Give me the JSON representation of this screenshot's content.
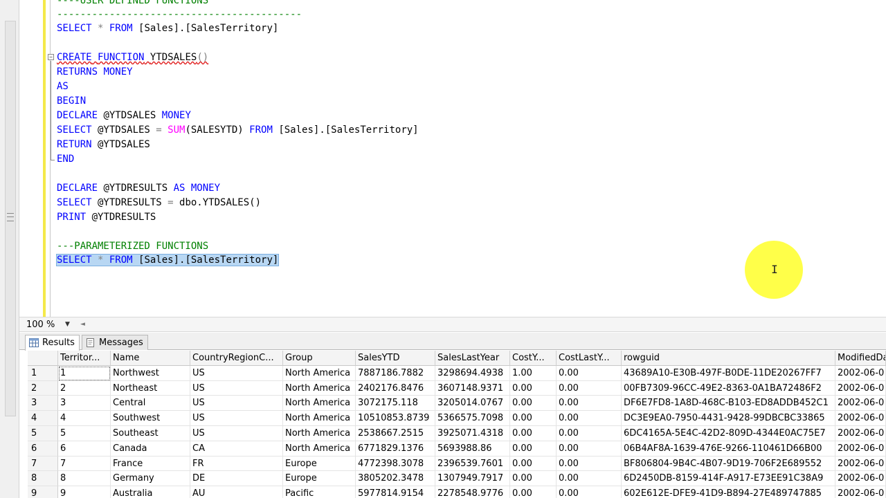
{
  "editor": {
    "lines": {
      "l0": "----USER DEFINED FUNCTIONS",
      "l1": "------------------------------------------",
      "l2_kw1": "SELECT",
      "l2_op": " * ",
      "l2_kw2": "FROM",
      "l2_rest": " [Sales].[SalesTerritory]",
      "l4_kw1": "CREATE",
      "l4_kw2": "FUNCTION",
      "l4_name": "YTDSALES",
      "l4_paren": "()",
      "l5_kw1": "RETURNS",
      "l5_kw2": "MONEY",
      "l6_kw": "AS",
      "l7_kw": "BEGIN",
      "l8_kw1": "DECLARE",
      "l8_var": " @YTDSALES ",
      "l8_kw2": "MONEY",
      "l9_kw1": "SELECT",
      "l9_var": " @YTDSALES ",
      "l9_eq": "=",
      "l9_fn": " SUM",
      "l9_arg": "(SALESYTD) ",
      "l9_kw2": "FROM",
      "l9_rest": " [Sales].[SalesTerritory]",
      "l10_kw": "RETURN",
      "l10_var": " @YTDSALES",
      "l11_kw": "END",
      "l13_kw1": "DECLARE",
      "l13_var": " @YTDRESULTS ",
      "l13_kw2": "AS",
      "l13_kw3": " MONEY",
      "l14_kw1": "SELECT",
      "l14_var": " @YTDRESULTS ",
      "l14_eq": "=",
      "l14_rest": " dbo.YTDSALES()",
      "l15_kw": "PRINT",
      "l15_var": " @YTDRESULTS",
      "l17": "---PARAMETERIZED FUNCTIONS",
      "l18_kw1": "SELECT",
      "l18_op": " * ",
      "l18_kw2": "FROM",
      "l18_rest": " [Sales].[SalesTerritory]"
    },
    "fold_symbol": "−",
    "ibeam": "I"
  },
  "zoom": {
    "value": "100 %",
    "arrow": "▼",
    "scroll_left": "◄"
  },
  "tabs": [
    {
      "label": "Results"
    },
    {
      "label": "Messages"
    }
  ],
  "grid": {
    "columns": [
      "Territor...",
      "Name",
      "CountryRegionC...",
      "Group",
      "SalesYTD",
      "SalesLastYear",
      "CostY...",
      "CostLastY...",
      "rowguid",
      "ModifiedDa"
    ],
    "rows": [
      {
        "n": "1",
        "cells": [
          "1",
          "Northwest",
          "US",
          "North America",
          "7887186.7882",
          "3298694.4938",
          "1.00",
          "0.00",
          "43689A10-E30B-497F-B0DE-11DE20267FF7",
          "2002-06-0"
        ]
      },
      {
        "n": "2",
        "cells": [
          "2",
          "Northeast",
          "US",
          "North America",
          "2402176.8476",
          "3607148.9371",
          "0.00",
          "0.00",
          "00FB7309-96CC-49E2-8363-0A1BA72486F2",
          "2002-06-0"
        ]
      },
      {
        "n": "3",
        "cells": [
          "3",
          "Central",
          "US",
          "North America",
          "3072175.118",
          "3205014.0767",
          "0.00",
          "0.00",
          "DF6E7FD8-1A8D-468C-B103-ED8ADDB452C1",
          "2002-06-0"
        ]
      },
      {
        "n": "4",
        "cells": [
          "4",
          "Southwest",
          "US",
          "North America",
          "10510853.8739",
          "5366575.7098",
          "0.00",
          "0.00",
          "DC3E9EA0-7950-4431-9428-99DBCBC33865",
          "2002-06-0"
        ]
      },
      {
        "n": "5",
        "cells": [
          "5",
          "Southeast",
          "US",
          "North America",
          "2538667.2515",
          "3925071.4318",
          "0.00",
          "0.00",
          "6DC4165A-5E4C-42D2-809D-4344E0AC75E7",
          "2002-06-0"
        ]
      },
      {
        "n": "6",
        "cells": [
          "6",
          "Canada",
          "CA",
          "North America",
          "6771829.1376",
          "5693988.86",
          "0.00",
          "0.00",
          "06B4AF8A-1639-476E-9266-110461D66B00",
          "2002-06-0"
        ]
      },
      {
        "n": "7",
        "cells": [
          "7",
          "France",
          "FR",
          "Europe",
          "4772398.3078",
          "2396539.7601",
          "0.00",
          "0.00",
          "BF806804-9B4C-4B07-9D19-706F2E689552",
          "2002-06-0"
        ]
      },
      {
        "n": "8",
        "cells": [
          "8",
          "Germany",
          "DE",
          "Europe",
          "3805202.3478",
          "1307949.7917",
          "0.00",
          "0.00",
          "6D2450DB-8159-414F-A917-E73EE91C38A9",
          "2002-06-0"
        ]
      },
      {
        "n": "9",
        "cells": [
          "9",
          "Australia",
          "AU",
          "Pacific",
          "5977814.9154",
          "2278548.9776",
          "0.00",
          "0.00",
          "602E612E-DFE9-41D9-B894-27E489747885",
          "2002-06-0"
        ]
      }
    ]
  },
  "colors": {
    "keyword": "#0000ff",
    "function": "#ff00ff",
    "comment": "#008000",
    "selection": "#b8d7f3",
    "cursor_halo": "#ffff3a",
    "margin": "#f4e94a"
  }
}
